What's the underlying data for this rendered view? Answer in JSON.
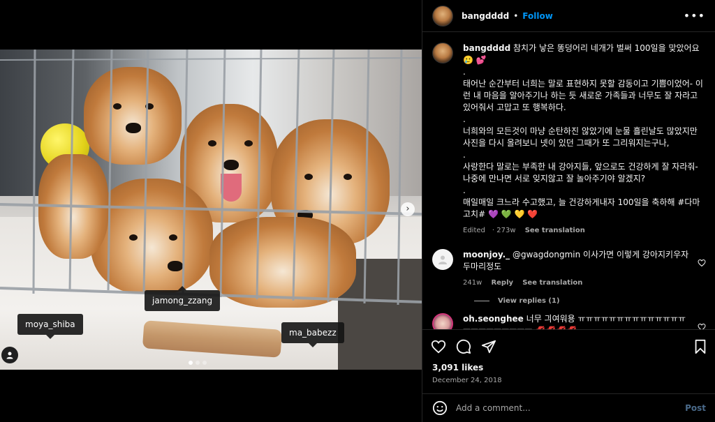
{
  "post": {
    "tags": [
      "moya_shiba",
      "jamong_zzang",
      "ma_babezz"
    ],
    "nav_next": "›"
  },
  "header": {
    "username": "bangdddd",
    "separator": "•",
    "follow_label": "Follow",
    "more_label": "•••"
  },
  "caption": {
    "username": "bangdddd",
    "lines": [
      "참치가 낳은 똥덩어리 네개가 벌써 100일을 맞았어요 🥲 💕",
      ".",
      "태어난 순간부터 너희는 말로 표현하지 못할 감동이고 기쁨이었어- 이런 내 마음을 알아주기나 하는 듯 새로운 가족들과 너무도 잘 자라고 있어줘서 고맙고 또 행복하다.",
      ".",
      "너희와의 모든것이 마냥 순탄하진 않았기에 눈물 흘린날도 많았지만 사진을 다시 올려보니 넷이 있던 그때가 또 그리워지는구나,",
      ".",
      "사랑한다 말로는 부족한 내 강아지들, 앞으로도 건강하게 잘 자라줘- 나중에 만나면 서로 잊지않고 잘 놀아주기야 알겠지?",
      ".",
      "매일매일 크느라 수고했고, 늘 건강하게내자 100일을 축하해 #다마고치# 💜 💚 💛 ❤️"
    ],
    "edited": "Edited",
    "time": "273w",
    "translate": "See translation"
  },
  "comments": [
    {
      "username": "moonjoy._",
      "text": "@gwagdongmin 이사가면 이렇게 강아지키우자 두마리정도",
      "time": "241w",
      "reply": "Reply",
      "translate": "See translation",
      "view_replies": "View replies (1)"
    },
    {
      "username": "oh.seonghee",
      "text": "너무 긔여워용 ㅠㅠㅠㅠㅠㅠㅠㅠㅠㅠㅠㅠㅠㅠㅠㅠㅠㅠㅠㅠㅠㅠㅠ 💋💋💋💋"
    }
  ],
  "stats": {
    "likes": "3,091 likes",
    "date": "December 24, 2018"
  },
  "composer": {
    "placeholder": "Add a comment...",
    "post_label": "Post"
  },
  "colors": {
    "accent": "#0095f6",
    "muted": "#a8a8a8",
    "divider": "#262626",
    "heart_red": "#ed4956"
  },
  "icons": [
    "heart-icon",
    "comment-icon",
    "share-icon",
    "bookmark-icon",
    "emoji-icon",
    "more-icon",
    "user-tag-icon",
    "chevron-right-icon"
  ]
}
